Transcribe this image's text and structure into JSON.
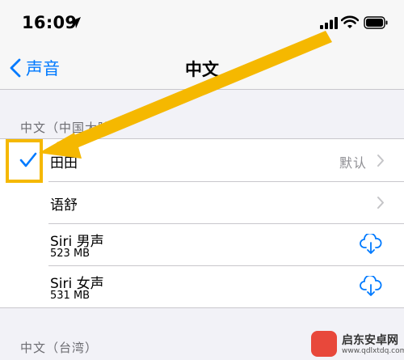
{
  "status_bar": {
    "time": "16:09"
  },
  "nav": {
    "back_label": "声音",
    "title": "中文"
  },
  "sections": [
    {
      "header": "中文（中国大陆）",
      "rows": [
        {
          "label": "田田",
          "value": "默认",
          "selected": true
        },
        {
          "label": "语舒"
        },
        {
          "title": "Siri 男声",
          "size": "523 MB"
        },
        {
          "title": "Siri 女声",
          "size": "531 MB"
        }
      ]
    },
    {
      "header": "中文（台湾）"
    }
  ],
  "watermark": {
    "title": "启东安卓网",
    "url": "www.qdlxtdq.com"
  },
  "colors": {
    "accent": "#007aff",
    "annotation": "#f5b800",
    "separator": "#c8c7cc",
    "background": "#f2f2f7"
  }
}
